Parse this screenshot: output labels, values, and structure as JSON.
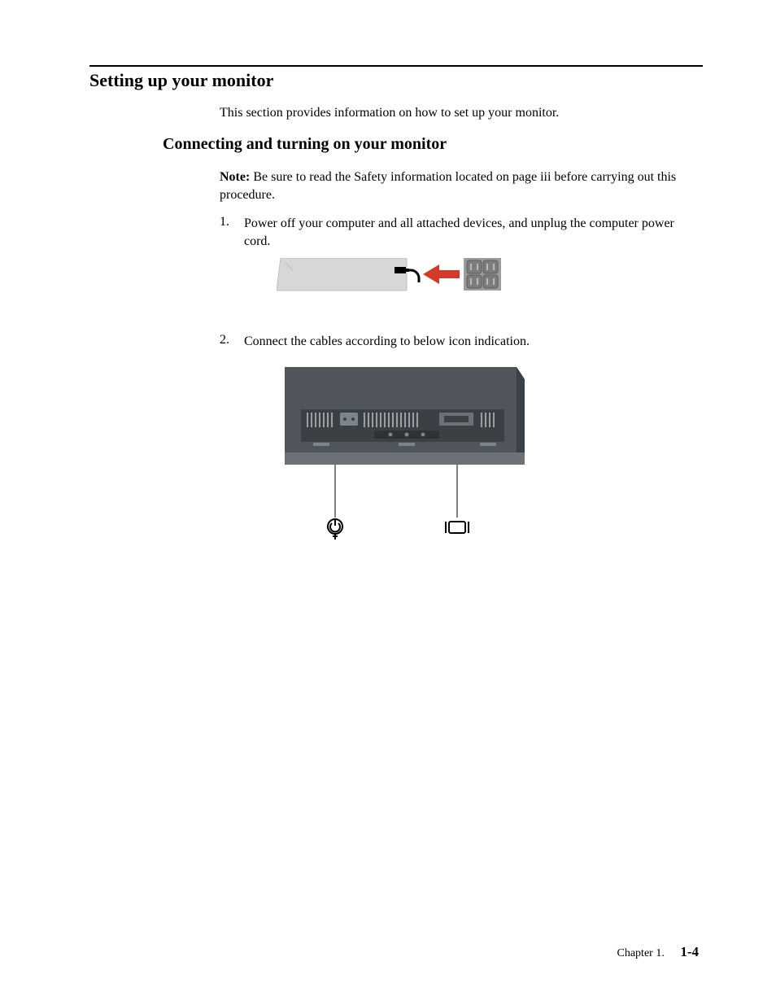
{
  "heading1": "Setting up your monitor",
  "intro": "This section provides information on how to set up your monitor.",
  "heading2": "Connecting and turning on your monitor",
  "note": {
    "label": "Note:",
    "text": " Be sure to read the Safety information located on page iii before carrying out this procedure."
  },
  "steps": [
    {
      "num": "1.",
      "text": "Power off your computer and all attached devices, and unplug the computer power cord."
    },
    {
      "num": "2.",
      "text": "Connect the cables according to below icon indication."
    }
  ],
  "footer": {
    "chapter": "Chapter 1.",
    "page": "1-4"
  }
}
